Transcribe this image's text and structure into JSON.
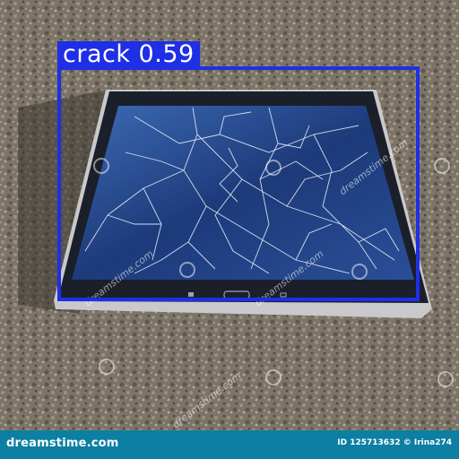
{
  "detection": {
    "label": "crack 0.59",
    "box_color": "#1f2fe6"
  },
  "watermark": {
    "text": "dreamstime.com"
  },
  "footer": {
    "brand": "dreamstime.com",
    "image_id": "ID 125713632 © Irina274",
    "background": "#0d7fa3"
  },
  "colors": {
    "asphalt": "#7a7266",
    "tablet_frame": "#1b1f2a",
    "screen": "#1d3a7a"
  }
}
